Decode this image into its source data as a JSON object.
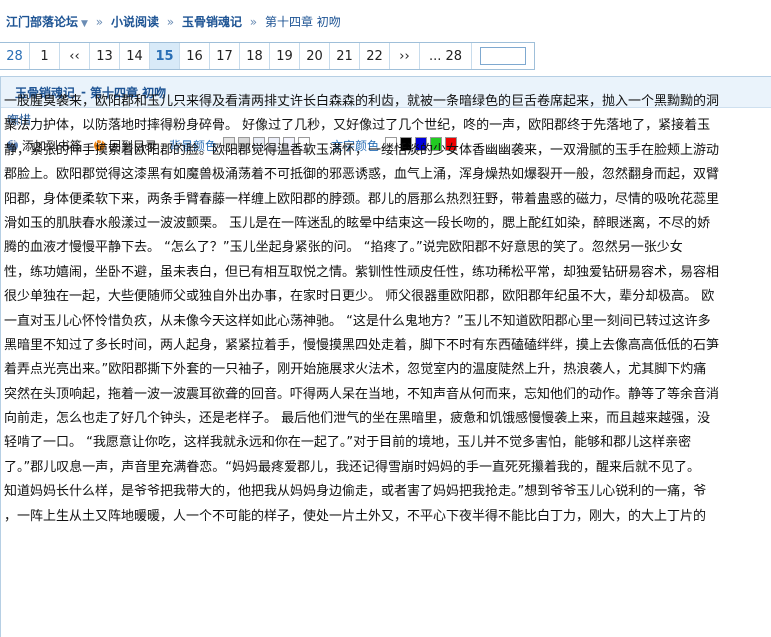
{
  "breadcrumb": {
    "forum": "江门部落论坛",
    "section": "小说阅读",
    "book": "玉骨销魂记",
    "chapter": "第十四章 初吻"
  },
  "pager": {
    "first": "28",
    "prev_count": "1",
    "prev_arrow": "‹‹",
    "pages": [
      "13",
      "14",
      "15",
      "16",
      "17",
      "18",
      "19",
      "20",
      "21",
      "22"
    ],
    "active_page": "15",
    "next_arrow": "››",
    "last": "... 28",
    "jump_placeholder": ""
  },
  "header": {
    "book_title": "玉骨销魂记",
    "separator": "-",
    "chapter_title": "第十四章 初吻",
    "author": "嘸惜"
  },
  "toolbar": {
    "bookmark_label": "添加到书签",
    "back_label": "回到目录",
    "bg_color_label": "背景颜色",
    "bg_colors": [
      "#e6e6e6",
      "#d8d8d8",
      "#e9eef8",
      "#eef0fa",
      "#f5f5ff",
      "#ffffff"
    ],
    "text_color_label": "文字颜色",
    "text_colors": [
      "#ffffff",
      "#000000",
      "#0000dd",
      "#22cc22",
      "#ee0000"
    ]
  },
  "content": {
    "lines": [
      "一股腥臭袭来，欧阳郡和玉儿只来得及看清两排丈许长白森森的利齿，就被一条暗绿色的巨舌卷席起来，抛入一个黑黝黝的洞",
      "聚法力护体，以防落地时摔得粉身碎骨。  好像过了几秒，又好像过了几个世纪，咚的一声，欧阳郡终于先落地了，紧接着玉",
      "静，紧张的伸手摸索着欧阳郡的脸。欧阳郡觉得温香软玉满怀，一缕恬淡的少女体香幽幽袭来，一双滑腻的玉手在脸颊上游动",
      "郡脸上。欧阳郡觉得这漆黑有如魔兽极涌荡着不可抵御的邪恶诱惑，血气上涌，浑身燥热如爆裂开一般，忽然翻身而起，双臂",
      "阳郡，身体便柔软下来，两条手臂春藤一样缠上欧阳郡的脖颈。郡儿的唇那么热烈狂野，带着蛊惑的磁力，尽情的吸吮花蕊里",
      "滑如玉的肌肤春水般漾过一波波颤栗。  玉儿是在一阵迷乱的眩晕中结束这一段长吻的，腮上酡红如染，醉眼迷离，不尽的娇",
      "腾的血液才慢慢平静下去。  “怎么了？”玉儿坐起身紧张的问。  “掐疼了。”说完欧阳郡不好意思的笑了。忽然另一张少女",
      "性，练功嬉闹，坐卧不避，虽未表白，但已有相互取悦之情。紫钏性性顽皮任性，练功稀松平常，却独爱钻研易容术，易容相",
      "很少单独在一起，大些便随师父或独自外出办事，在家时日更少。 师父很器重欧阳郡，欧阳郡年纪虽不大，辈分却极高。 欧",
      "一直对玉儿心怀怜惜负疚，从未像今天这样如此心荡神驰。  “这是什么鬼地方？”玉儿不知道欧阳郡心里一刻间已转过这许多",
      "黑暗里不知过了多长时间，两人起身，紧紧拉着手，慢慢摸黑四处走着，脚下不时有东西磕磕绊绊，摸上去像高高低低的石笋",
      "着弄点光亮出来。”欧阳郡撕下外套的一只袖子，刚开始施展求火法术，忽觉室内的温度陡然上升，热浪袭人，尤其脚下灼痛",
      "突然在头顶响起，拖着一波一波震耳欲聋的回音。吓得两人呆在当地，不知声音从何而来，忘知他们的动作。静等了等余音消",
      "向前走，怎么也走了好几个钟头，还是老样子。  最后他们泄气的坐在黑暗里，疲惫和饥饿感慢慢袭上来，而且越来越强，没",
      "轻啃了一口。  “我愿意让你吃，这样我就永远和你在一起了。”对于目前的境地，玉儿并不觉多害怕，能够和郡儿这样亲密",
      "了。”郡儿叹息一声，声音里充满眷恋。“妈妈最疼爱郡儿，我还记得雪崩时妈妈的手一直死死攥着我的，醒来后就不见了。",
      "知道妈妈长什么样，是爷爷把我带大的，他把我从妈妈身边偷走，或者害了妈妈把我抢走。”想到爷爷玉儿心锐利的一痛，爷",
      "，一阵上生从土又阵地暖暖，人一个不可能的样子，使处一片土外又，不平心下夜半得不能比白丁力，刚大，的大上丁片的"
    ]
  }
}
